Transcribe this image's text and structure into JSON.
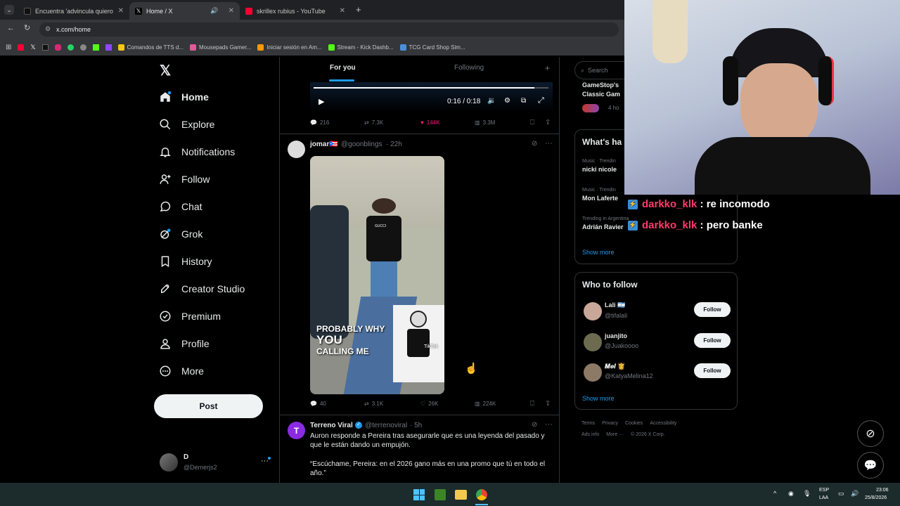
{
  "browser": {
    "tabs": [
      {
        "title": "Encuentra 'advincula quiero ke..."
      },
      {
        "title": "Home / X"
      },
      {
        "title": "skrillex rubius - YouTube"
      }
    ],
    "url": "x.com/home",
    "bookmarks": [
      "Comandos de TTS d...",
      "Mousepads Gamer...",
      "Iniciar sesión en Am...",
      "Stream - Kick Dashb...",
      "TCG Card Shop Sim..."
    ]
  },
  "nav": {
    "items": [
      {
        "label": "Home"
      },
      {
        "label": "Explore"
      },
      {
        "label": "Notifications"
      },
      {
        "label": "Follow"
      },
      {
        "label": "Chat"
      },
      {
        "label": "Grok"
      },
      {
        "label": "History"
      },
      {
        "label": "Creator Studio"
      },
      {
        "label": "Premium"
      },
      {
        "label": "Profile"
      },
      {
        "label": "More"
      }
    ],
    "post_label": "Post",
    "account": {
      "name": "D",
      "handle": "@Demerjs2"
    }
  },
  "feed": {
    "tabs": {
      "for_you": "For you",
      "following": "Following"
    },
    "video": {
      "time": "0:16 / 0:18",
      "progress": 0.94
    },
    "post0_stats": {
      "replies": "216",
      "reposts": "7.3K",
      "likes": "144K",
      "views": "3.3M"
    },
    "post1": {
      "author": "jomar🇵🇷",
      "handle": "@goonblings",
      "time": "· 22h",
      "overlay_line1": "PROBABLY WHY",
      "overlay_line2": "YOU",
      "overlay_line3": "CALLING ME",
      "tiktok_label": "TikTok",
      "shirt_text": "GUCCI",
      "stats": {
        "replies": "40",
        "reposts": "3.1K",
        "likes": "26K",
        "views": "224K"
      }
    },
    "post2": {
      "author": "Terreno Viral",
      "handle": "@terrenoviral",
      "time": "· 5h",
      "text1": "Auron responde a Pereira tras asegurarle que es una leyenda del pasado y que le están dando un empujón.",
      "text2": "“Escúchame, Pereira: en el 2026 gano más en una promo que tú en todo el año.”"
    }
  },
  "sidebar": {
    "search_placeholder": "Search",
    "promo": {
      "line1": "GameStop's",
      "line2": "Classic Gam",
      "time": "4 ho"
    },
    "whats_happening": "What's ha",
    "trends": [
      {
        "category": "Music · Trendin",
        "name": "nicki nicole"
      },
      {
        "category": "Music · Trendin",
        "name": "Mon Laferte"
      },
      {
        "category": "Trending in Argentina",
        "name": "Adrián Ravier"
      }
    ],
    "show_more": "Show more",
    "who_to_follow": "Who to follow",
    "suggestions": [
      {
        "name": "Lali 🇦🇷",
        "handle": "@tifalali"
      },
      {
        "name": "juanjito",
        "handle": "@Juakoooo"
      },
      {
        "name": "𝑴𝒆𝒍 👸",
        "handle": "@KatyaMelina12"
      }
    ],
    "follow_label": "Follow",
    "footer": {
      "line1": [
        "Terms",
        "Privacy",
        "Cookies",
        "Accessibility"
      ],
      "line2": [
        "Ads info",
        "More ···",
        "© 2026 X Corp."
      ]
    }
  },
  "stream_chat": [
    {
      "user": "darkko_klk",
      "message": " : re incomodo"
    },
    {
      "user": "darkko_klk",
      "message": " : pero banke"
    }
  ],
  "taskbar": {
    "lang1": "ESP",
    "lang2": "LAA",
    "time": "23:06",
    "date": "25/8/2026"
  },
  "colors": {
    "accent": "#1d9bf0",
    "like": "#f91880",
    "chat_user": "#ff3b6b",
    "taskbar": "#1c2b2b"
  }
}
